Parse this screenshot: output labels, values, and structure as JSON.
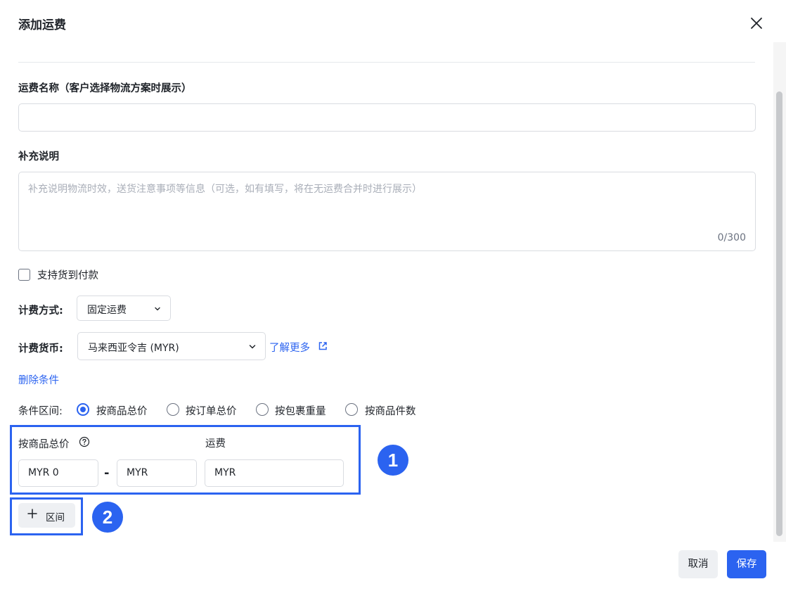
{
  "dialog": {
    "title": "添加运费"
  },
  "form": {
    "name_label": "运费名称（客户选择物流方案时展示）",
    "name_value": "",
    "desc_label": "补充说明",
    "desc_placeholder": "补充说明物流时效，送货注意事项等信息（可选，如有填写，将在无运费合并时进行展示）",
    "desc_counter": "0/300",
    "cod_label": "支持货到付款",
    "cod_checked": false,
    "billing_method_label": "计费方式:",
    "billing_method_value": "固定运费",
    "currency_label": "计费货币:",
    "currency_value": "马来西亚令吉 (MYR)",
    "learn_more": "了解更多",
    "delete_condition": "删除条件",
    "condition_label": "条件区间:",
    "condition_options": [
      {
        "label": "按商品总价",
        "selected": true
      },
      {
        "label": "按订单总价",
        "selected": false
      },
      {
        "label": "按包裹重量",
        "selected": false
      },
      {
        "label": "按商品件数",
        "selected": false
      }
    ],
    "range": {
      "header_label": "按商品总价",
      "fee_label": "运费",
      "min_value": "MYR 0",
      "max_value": "MYR",
      "fee_value": "MYR"
    },
    "add_range_label": "区间"
  },
  "annotations": {
    "badge1": "1",
    "badge2": "2"
  },
  "footer": {
    "cancel_label": "取消",
    "save_label": "保存"
  },
  "colors": {
    "accent": "#2b63f0",
    "border": "#d9dce1",
    "muted_button": "#eef0f3"
  }
}
